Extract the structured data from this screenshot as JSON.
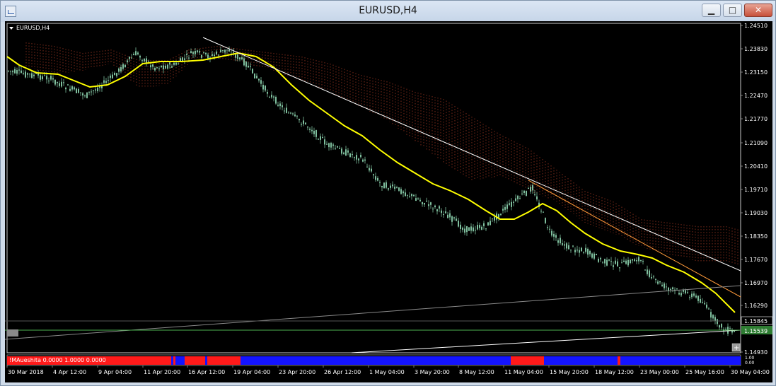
{
  "window": {
    "title": "EURUSD,H4",
    "minimize_glyph": "▁",
    "maximize_glyph": "□",
    "close_glyph": "✕"
  },
  "chart": {
    "symbol_label": "EURUSD,H4",
    "price_labels": [
      "1.24510",
      "1.23830",
      "1.23150",
      "1.22470",
      "1.21770",
      "1.21090",
      "1.20410",
      "1.19710",
      "1.19030",
      "1.18350",
      "1.17670",
      "1.16970",
      "1.16290",
      "1.14930"
    ],
    "current_price": "1.15539",
    "line_price": "1.15845",
    "indicator_label": "!MAueshita 0.0000 1.0000 0.0000",
    "indicator_scale": [
      "1.00",
      "0.00"
    ],
    "time_labels": [
      "30 Mar 2018",
      "4 Apr 12:00",
      "9 Apr 04:00",
      "11 Apr 20:00",
      "16 Apr 12:00",
      "19 Apr 04:00",
      "23 Apr 20:00",
      "26 Apr 12:00",
      "1 May 04:00",
      "3 May 20:00",
      "8 May 12:00",
      "11 May 04:00",
      "15 May 20:00",
      "18 May 12:00",
      "23 May 00:00",
      "25 May 16:00",
      "30 May 04:00"
    ],
    "colors": {
      "background": "#000000",
      "candle": "#7fbf9e",
      "ma_line": "#ffff00",
      "cloud": "#7a2a1a",
      "trend_line": "#ffffff",
      "indicator_up": "#ff1a1a",
      "indicator_down": "#1414ff",
      "current_price_bg": "#2e7d32"
    }
  }
}
